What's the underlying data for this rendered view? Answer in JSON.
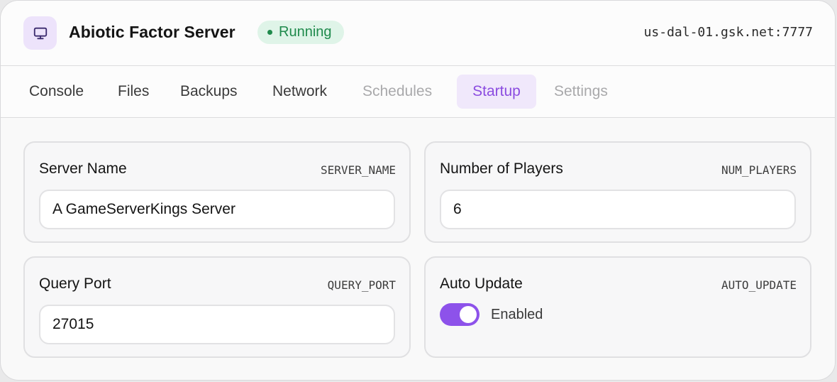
{
  "header": {
    "icon": "monitor-icon",
    "title": "Abiotic Factor Server",
    "status": "Running",
    "status_color": "#1f8a4c",
    "address": "us-dal-01.gsk.net:7777"
  },
  "tabs": [
    {
      "label": "Console",
      "state": "normal"
    },
    {
      "label": "Files",
      "state": "normal"
    },
    {
      "label": "Backups",
      "state": "normal"
    },
    {
      "label": "Network",
      "state": "normal"
    },
    {
      "label": "Schedules",
      "state": "disabled"
    },
    {
      "label": "Startup",
      "state": "active"
    },
    {
      "label": "Settings",
      "state": "disabled"
    }
  ],
  "variables": {
    "server_name": {
      "label": "Server Name",
      "key": "SERVER_NAME",
      "value": "A GameServerKings Server"
    },
    "num_players": {
      "label": "Number of Players",
      "key": "NUM_PLAYERS",
      "value": "6"
    },
    "query_port": {
      "label": "Query Port",
      "key": "QUERY_PORT",
      "value": "27015"
    },
    "auto_update": {
      "label": "Auto Update",
      "key": "AUTO_UPDATE",
      "state": "Enabled",
      "on": true
    }
  },
  "colors": {
    "accent": "#8d52ea",
    "active_tab_text": "#8b4ce0",
    "active_tab_bg": "#f0e8fb",
    "status_bg": "#dff4e8"
  }
}
